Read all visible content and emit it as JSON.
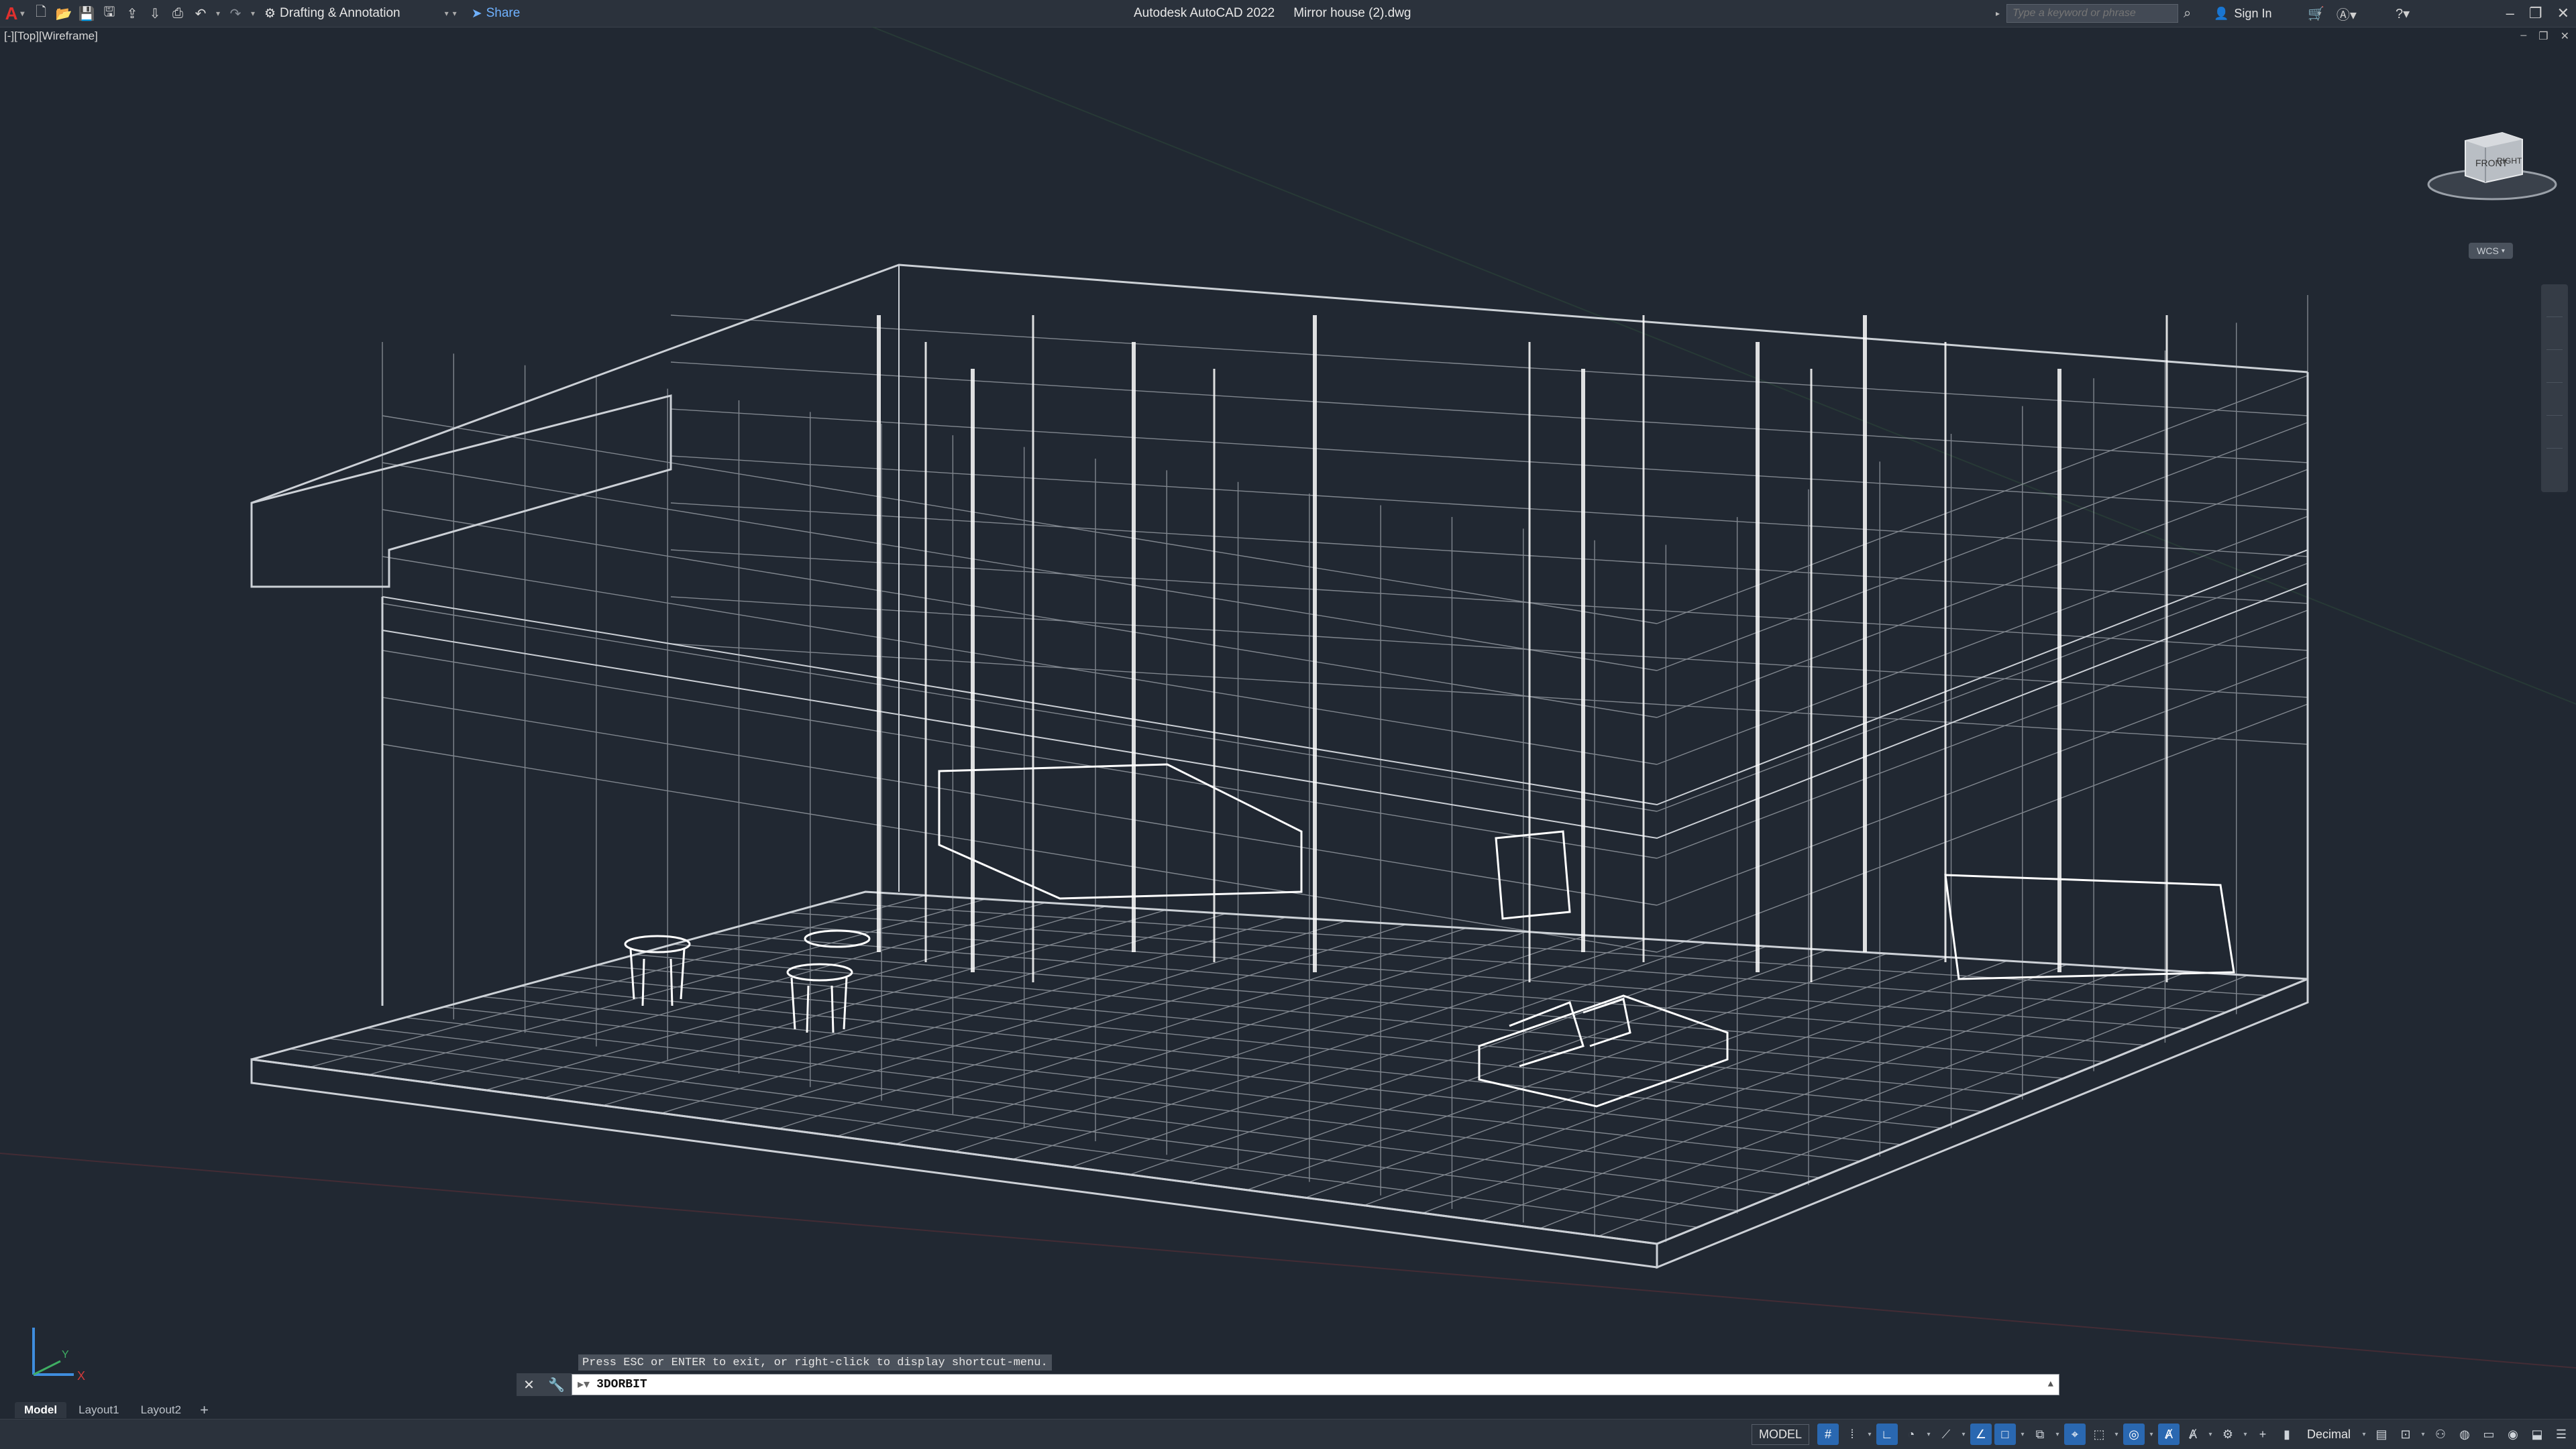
{
  "app": {
    "title": "Autodesk AutoCAD 2022",
    "document": "Mirror house (2).dwg",
    "logo_letter": "A"
  },
  "quick_access": {
    "workspace": "Drafting & Annotation",
    "share_label": "Share",
    "icons": [
      "new-icon",
      "open-icon",
      "save-icon",
      "save-as-icon",
      "open-web-icon",
      "save-web-icon",
      "plot-icon",
      "undo-icon",
      "redo-icon",
      "gear-icon",
      "share-icon"
    ]
  },
  "search": {
    "placeholder": "Type a keyword or phrase"
  },
  "account": {
    "sign_in": "Sign In"
  },
  "viewport": {
    "label": "[-][Top][Wireframe]"
  },
  "viewcube": {
    "front": "FRONT",
    "right": "RIGHT",
    "top": "TOP",
    "wcs": "WCS"
  },
  "command": {
    "hint": "Press ESC or ENTER to exit, or right-click to display shortcut-menu.",
    "current": "3DORBIT"
  },
  "layout_tabs": [
    "Model",
    "Layout1",
    "Layout2"
  ],
  "status": {
    "model_label": "MODEL",
    "units_label": "Decimal"
  },
  "ucs": {
    "x": "X",
    "y": "Y"
  },
  "colors": {
    "canvas": "#212832",
    "wire": "#dfe3e8",
    "accent": "#2a68b1",
    "logo": "#e0302e"
  }
}
